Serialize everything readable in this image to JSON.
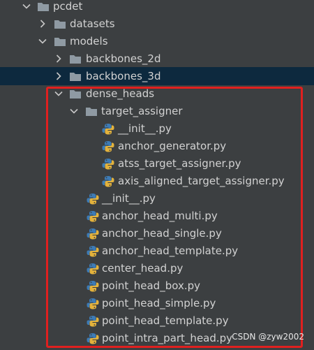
{
  "project_tree": {
    "items": [
      {
        "label": "pcdet",
        "kind": "folder",
        "expanded": true,
        "level": 0,
        "icon": "folder-icon"
      },
      {
        "label": "datasets",
        "kind": "folder",
        "expanded": false,
        "level": 1,
        "icon": "folder-icon"
      },
      {
        "label": "models",
        "kind": "folder",
        "expanded": true,
        "level": 1,
        "icon": "folder-icon"
      },
      {
        "label": "backbones_2d",
        "kind": "folder",
        "expanded": false,
        "level": 2,
        "icon": "folder-icon"
      },
      {
        "label": "backbones_3d",
        "kind": "folder",
        "expanded": false,
        "level": 2,
        "icon": "folder-icon",
        "selected": true
      },
      {
        "label": "dense_heads",
        "kind": "folder",
        "expanded": true,
        "level": 2,
        "icon": "folder-icon"
      },
      {
        "label": "target_assigner",
        "kind": "folder",
        "expanded": true,
        "level": 3,
        "icon": "folder-icon"
      },
      {
        "label": "__init__.py",
        "kind": "file",
        "level": 4,
        "icon": "python-file-icon"
      },
      {
        "label": "anchor_generator.py",
        "kind": "file",
        "level": 4,
        "icon": "python-file-icon"
      },
      {
        "label": "atss_target_assigner.py",
        "kind": "file",
        "level": 4,
        "icon": "python-file-icon"
      },
      {
        "label": "axis_aligned_target_assigner.py",
        "kind": "file",
        "level": 4,
        "icon": "python-file-icon"
      },
      {
        "label": "__init__.py",
        "kind": "file",
        "level": 3,
        "icon": "python-file-icon"
      },
      {
        "label": "anchor_head_multi.py",
        "kind": "file",
        "level": 3,
        "icon": "python-file-icon"
      },
      {
        "label": "anchor_head_single.py",
        "kind": "file",
        "level": 3,
        "icon": "python-file-icon"
      },
      {
        "label": "anchor_head_template.py",
        "kind": "file",
        "level": 3,
        "icon": "python-file-icon"
      },
      {
        "label": "center_head.py",
        "kind": "file",
        "level": 3,
        "icon": "python-file-icon"
      },
      {
        "label": "point_head_box.py",
        "kind": "file",
        "level": 3,
        "icon": "python-file-icon"
      },
      {
        "label": "point_head_simple.py",
        "kind": "file",
        "level": 3,
        "icon": "python-file-icon"
      },
      {
        "label": "point_head_template.py",
        "kind": "file",
        "level": 3,
        "icon": "python-file-icon"
      },
      {
        "label": "point_intra_part_head.py",
        "kind": "file",
        "level": 3,
        "icon": "python-file-icon"
      }
    ]
  },
  "watermark": "CSDN @zyw2002",
  "colors": {
    "background": "#3c3f41",
    "selected_row": "#0d293e",
    "text": "#d2d2d2",
    "highlight_border": "#e0201f",
    "folder_icon": "#8f9aa3",
    "python_blue": "#3d7bb5",
    "python_yellow": "#e3b23c"
  }
}
